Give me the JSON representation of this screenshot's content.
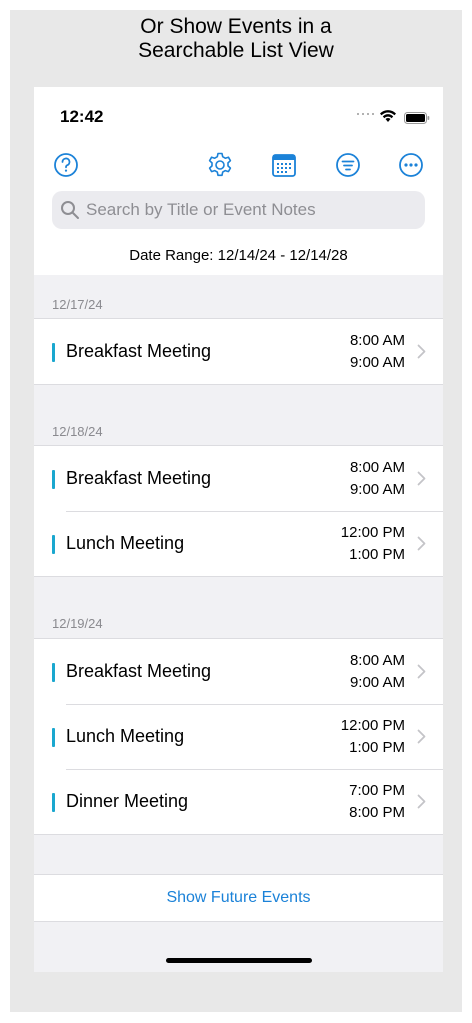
{
  "caption": {
    "line1": "Or Show Events in a",
    "line2": "Searchable List View"
  },
  "status_bar": {
    "time": "12:42"
  },
  "toolbar": {
    "icons": [
      "help-icon",
      "gear-icon",
      "calendar-icon",
      "filter-icon",
      "more-icon"
    ]
  },
  "search": {
    "placeholder": "Search by Title or Event Notes",
    "value": ""
  },
  "date_range": "Date Range: 12/14/24 - 12/14/28",
  "sections": [
    {
      "date": "12/17/24",
      "events": [
        {
          "title": "Breakfast Meeting",
          "start": "8:00 AM",
          "end": "9:00 AM"
        }
      ]
    },
    {
      "date": "12/18/24",
      "events": [
        {
          "title": "Breakfast Meeting",
          "start": "8:00 AM",
          "end": "9:00 AM"
        },
        {
          "title": "Lunch Meeting",
          "start": "12:00 PM",
          "end": "1:00 PM"
        }
      ]
    },
    {
      "date": "12/19/24",
      "events": [
        {
          "title": "Breakfast Meeting",
          "start": "8:00 AM",
          "end": "9:00 AM"
        },
        {
          "title": "Lunch Meeting",
          "start": "12:00 PM",
          "end": "1:00 PM"
        },
        {
          "title": "Dinner Meeting",
          "start": "7:00 PM",
          "end": "8:00 PM"
        }
      ]
    }
  ],
  "footer": {
    "show_future_label": "Show Future Events"
  },
  "colors": {
    "accent": "#1b82d8",
    "event_bar": "#1aa7cf",
    "background": "#f1f1f4"
  }
}
